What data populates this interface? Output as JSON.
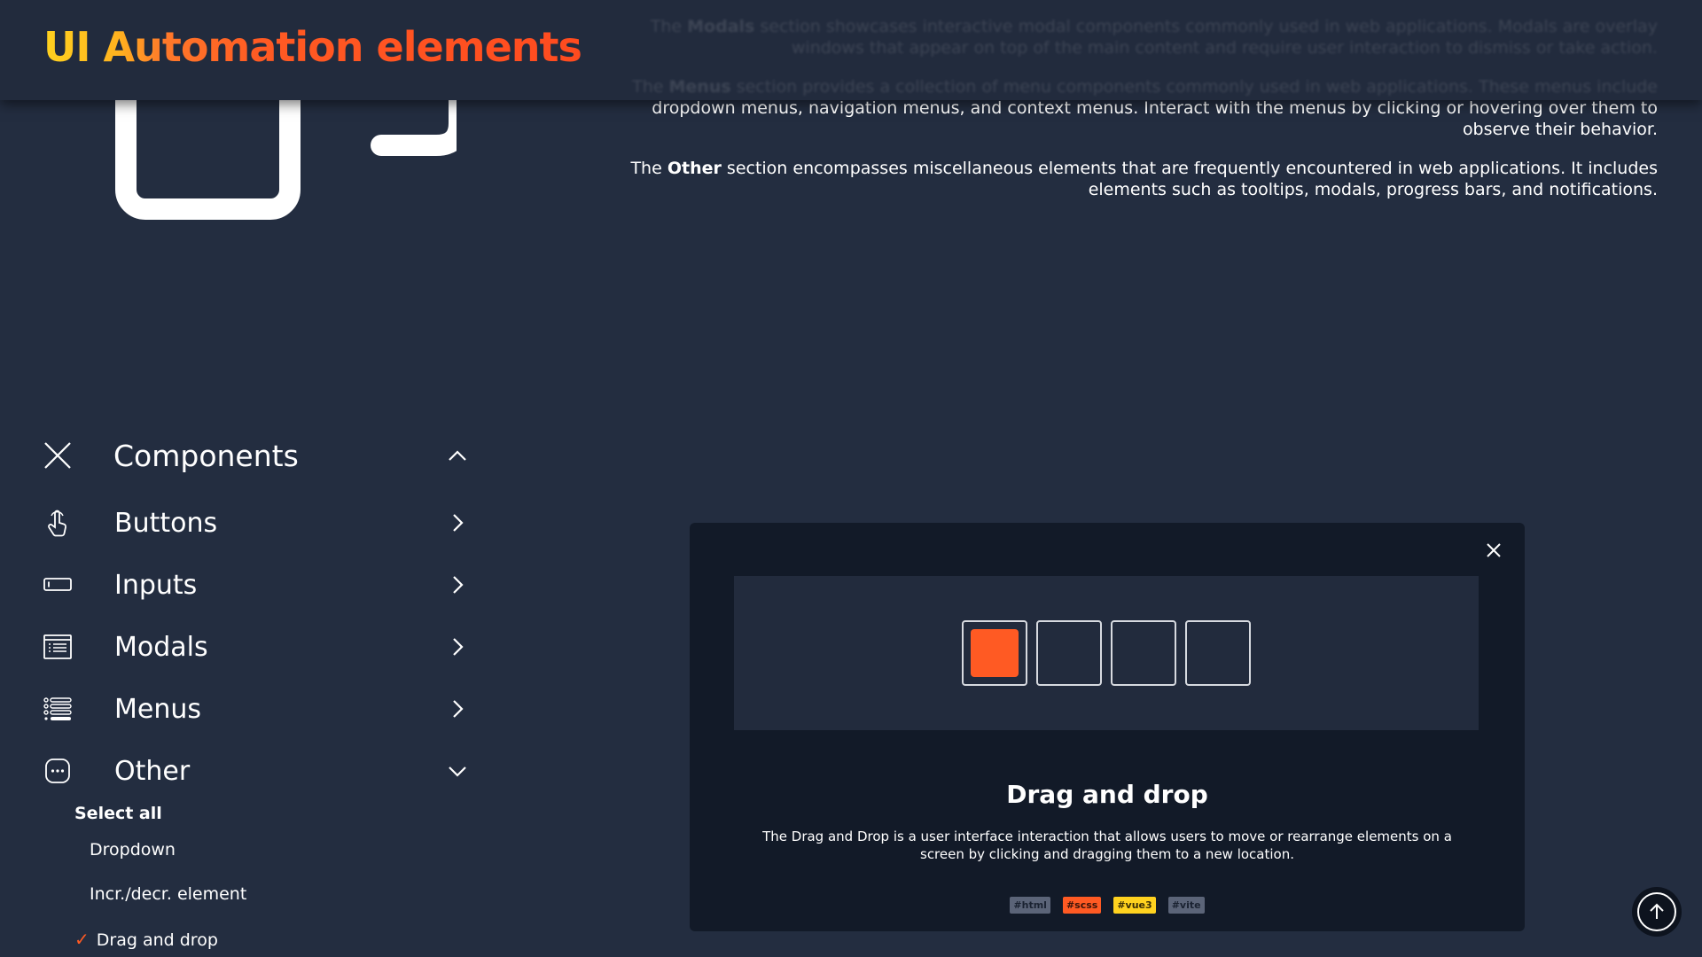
{
  "header": {
    "title": "UI Automation elements"
  },
  "descriptions": {
    "modals": {
      "prefix": "The ",
      "keyword": "Modals",
      "text": " section showcases interactive modal components commonly used in web applications. Modals are overlay windows that appear on top of the main content and require user interaction to dismiss or take action."
    },
    "menus": {
      "prefix": "The ",
      "keyword": "Menus",
      "text_faded": " section provides a collection of menu components commonly used in web applications. These menus include",
      "text_clear": "dropdown menus, navigation menus, and context menus. Interact with the menus by clicking or hovering over them to observe their behavior."
    },
    "other": {
      "prefix": "The ",
      "keyword": "Other",
      "text": " section encompasses miscellaneous elements that are frequently encountered in web applications. It includes elements such as tooltips, modals, progress bars, and notifications."
    }
  },
  "sidebar": {
    "components_label": "Components",
    "items": [
      {
        "label": "Buttons",
        "icon": "hand-pointer-icon"
      },
      {
        "label": "Inputs",
        "icon": "input-field-icon"
      },
      {
        "label": "Modals",
        "icon": "modal-window-icon"
      },
      {
        "label": "Menus",
        "icon": "menu-list-icon"
      },
      {
        "label": "Other",
        "icon": "more-dots-icon"
      }
    ],
    "other_sub": {
      "select_all": "Select all",
      "items": [
        {
          "label": "Dropdown",
          "checked": false
        },
        {
          "label": "Incr./decr. element",
          "checked": false
        },
        {
          "label": "Drag and drop",
          "checked": true
        }
      ],
      "check_mark": "✓"
    }
  },
  "card": {
    "title": "Drag and drop",
    "description": "The Drag and Drop is a user interface interaction that allows users to move or rearrange elements on a screen by clicking and dragging them to a new location.",
    "tags": [
      "#html",
      "#scss",
      "#vue3",
      "#vite"
    ],
    "slot_count": 4,
    "draggable_slot_index": 0
  },
  "colors": {
    "background": "#232d40",
    "header": "#222b3d",
    "accent_orange": "#ff5a23",
    "accent_yellow": "#ffd21f",
    "card": "#121a28"
  }
}
